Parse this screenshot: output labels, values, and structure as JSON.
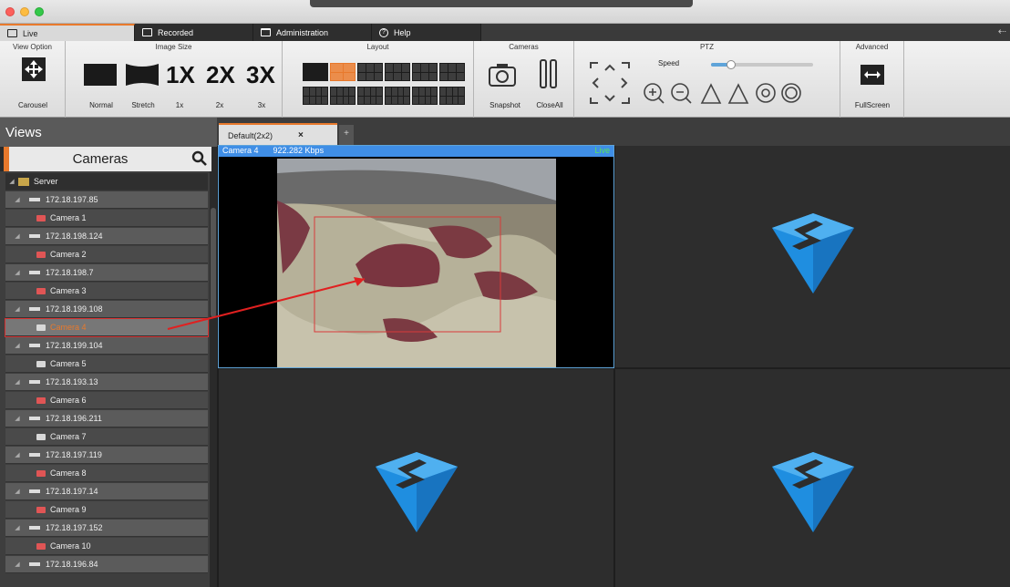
{
  "window": {
    "title": ""
  },
  "main_tabs": [
    {
      "label": "Live",
      "icon": "monitor-icon"
    },
    {
      "label": "Recorded",
      "icon": "play-icon"
    },
    {
      "label": "Administration",
      "icon": "folder-icon"
    },
    {
      "label": "Help",
      "icon": "help-icon"
    }
  ],
  "ribbon": {
    "view_option": {
      "title": "View Option",
      "carousel": "Carousel"
    },
    "image_size": {
      "title": "Image Size",
      "normal": "Normal",
      "stretch": "Stretch",
      "x1": "1x",
      "x2": "2x",
      "x3": "3x",
      "big1": "1X",
      "big2": "2X",
      "big3": "3X"
    },
    "layout": {
      "title": "Layout"
    },
    "cameras": {
      "title": "Cameras",
      "snapshot": "Snapshot",
      "close_all": "CloseAll"
    },
    "ptz": {
      "title": "PTZ",
      "speed": "Speed",
      "speed_value": 0.2
    },
    "advanced": {
      "title": "Advanced",
      "fullscreen": "FullScreen"
    }
  },
  "views": {
    "title": "Views",
    "cameras_title": "Cameras",
    "tree": [
      {
        "type": "server",
        "label": "Server"
      },
      {
        "type": "ip",
        "label": "172.18.197.85"
      },
      {
        "type": "cam",
        "label": "Camera 1",
        "status": "red"
      },
      {
        "type": "ip",
        "label": "172.18.198.124"
      },
      {
        "type": "cam",
        "label": "Camera 2",
        "status": "red"
      },
      {
        "type": "ip",
        "label": "172.18.198.7"
      },
      {
        "type": "cam",
        "label": "Camera 3",
        "status": "red"
      },
      {
        "type": "ip",
        "label": "172.18.199.108"
      },
      {
        "type": "cam",
        "label": "Camera 4",
        "status": "white",
        "selected": true
      },
      {
        "type": "ip",
        "label": "172.18.199.104"
      },
      {
        "type": "cam",
        "label": "Camera 5",
        "status": "white"
      },
      {
        "type": "ip",
        "label": "172.18.193.13"
      },
      {
        "type": "cam",
        "label": "Camera 6",
        "status": "red"
      },
      {
        "type": "ip",
        "label": "172.18.196.211"
      },
      {
        "type": "cam",
        "label": "Camera 7",
        "status": "white"
      },
      {
        "type": "ip",
        "label": "172.18.197.119"
      },
      {
        "type": "cam",
        "label": "Camera 8",
        "status": "red"
      },
      {
        "type": "ip",
        "label": "172.18.197.14"
      },
      {
        "type": "cam",
        "label": "Camera 9",
        "status": "red"
      },
      {
        "type": "ip",
        "label": "172.18.197.152"
      },
      {
        "type": "cam",
        "label": "Camera 10",
        "status": "red"
      },
      {
        "type": "ip",
        "label": "172.18.196.84"
      }
    ]
  },
  "view_tab": {
    "label": "Default(2x2)",
    "close": "×",
    "add": "+"
  },
  "camera_view": {
    "name": "Camera 4",
    "bitrate": "922.282 Kbps",
    "status": "Live"
  },
  "colors": {
    "accent": "#e8792c",
    "info_bar": "#3f8ee6",
    "logo": "#1f8ee0"
  }
}
